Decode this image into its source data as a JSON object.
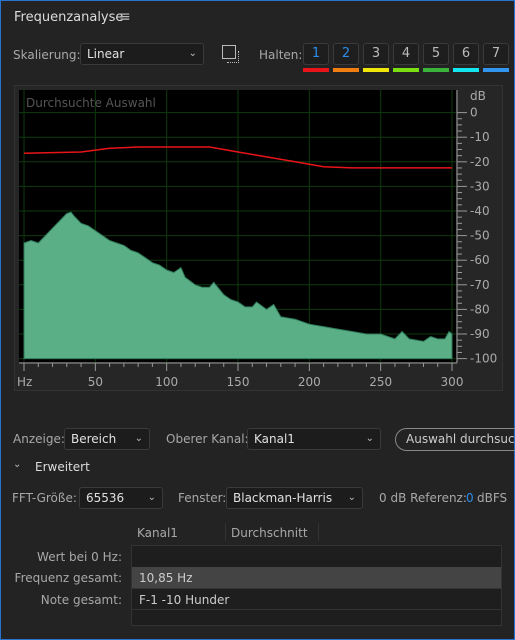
{
  "panel": {
    "title": "Frequenzanalyse",
    "menu_icon": "hamburger-icon"
  },
  "toolbar": {
    "scaling_label": "Skalierung:",
    "scaling_value": "Linear",
    "snapshot_icon": "snapshot-icon",
    "hold_label": "Halten:",
    "hold_buttons": [
      {
        "label": "1",
        "color": "#e8141a",
        "active": true
      },
      {
        "label": "2",
        "color": "#f07e10",
        "active": true
      },
      {
        "label": "3",
        "color": "#f0e60a",
        "active": false
      },
      {
        "label": "4",
        "color": "#7ae014",
        "active": false
      },
      {
        "label": "5",
        "color": "#3cb43c",
        "active": false
      },
      {
        "label": "6",
        "color": "#14e6f0",
        "active": false
      },
      {
        "label": "7",
        "color": "#3296f0",
        "active": false
      }
    ]
  },
  "chart_data": {
    "type": "area",
    "title": "Durchsuchte Auswahl",
    "xlabel": "Hz",
    "ylabel": "dB",
    "xlim": [
      0,
      300
    ],
    "ylim": [
      -100,
      0
    ],
    "grid": true,
    "x_ticks": [
      "50",
      "100",
      "150",
      "200",
      "250",
      "300"
    ],
    "y_ticks": [
      "0",
      "-10",
      "-20",
      "-30",
      "-40",
      "-50",
      "-60",
      "-70",
      "-80",
      "-90",
      "-100"
    ],
    "series": [
      {
        "kind": "spectrum",
        "color": "#5aaf87",
        "points": [
          [
            0,
            -53
          ],
          [
            5,
            -52
          ],
          [
            10,
            -53
          ],
          [
            15,
            -50
          ],
          [
            20,
            -47
          ],
          [
            25,
            -44
          ],
          [
            30,
            -41
          ],
          [
            33,
            -40.5
          ],
          [
            35,
            -42
          ],
          [
            40,
            -45
          ],
          [
            45,
            -46
          ],
          [
            50,
            -48
          ],
          [
            55,
            -50
          ],
          [
            60,
            -52
          ],
          [
            65,
            -53
          ],
          [
            70,
            -54
          ],
          [
            75,
            -56
          ],
          [
            80,
            -57
          ],
          [
            85,
            -59
          ],
          [
            90,
            -61
          ],
          [
            95,
            -62
          ],
          [
            100,
            -64
          ],
          [
            105,
            -65
          ],
          [
            110,
            -63
          ],
          [
            113,
            -67
          ],
          [
            120,
            -70
          ],
          [
            125,
            -71
          ],
          [
            130,
            -71
          ],
          [
            133,
            -69
          ],
          [
            140,
            -74
          ],
          [
            145,
            -76
          ],
          [
            150,
            -77
          ],
          [
            155,
            -79
          ],
          [
            160,
            -79
          ],
          [
            163,
            -77
          ],
          [
            170,
            -80
          ],
          [
            175,
            -78
          ],
          [
            180,
            -83
          ],
          [
            190,
            -84
          ],
          [
            200,
            -86
          ],
          [
            210,
            -87
          ],
          [
            220,
            -88
          ],
          [
            230,
            -89
          ],
          [
            240,
            -90
          ],
          [
            250,
            -90
          ],
          [
            255,
            -91
          ],
          [
            260,
            -92
          ],
          [
            265,
            -89
          ],
          [
            270,
            -92
          ],
          [
            280,
            -93
          ],
          [
            285,
            -91
          ],
          [
            290,
            -92
          ],
          [
            295,
            -92
          ],
          [
            298,
            -89
          ],
          [
            300,
            -90
          ]
        ]
      },
      {
        "kind": "hold",
        "color": "#e8141a",
        "points": [
          [
            0,
            -16.5
          ],
          [
            40,
            -16
          ],
          [
            60,
            -14.5
          ],
          [
            80,
            -14
          ],
          [
            130,
            -14
          ],
          [
            150,
            -16
          ],
          [
            170,
            -18
          ],
          [
            190,
            -20
          ],
          [
            210,
            -22
          ],
          [
            230,
            -22.5
          ],
          [
            300,
            -22.5
          ]
        ]
      }
    ]
  },
  "controls": {
    "display_label": "Anzeige:",
    "display_value": "Bereich",
    "channel_label": "Oberer Kanal:",
    "channel_value": "Kanal1",
    "scan_button": "Auswahl durchsuchen",
    "advanced_label": "Erweitert",
    "fft_label": "FFT-Größe:",
    "fft_value": "65536",
    "window_label": "Fenster:",
    "window_value": "Blackman-Harris",
    "ref_label": "0 dB Referenz:",
    "ref_value": "0",
    "ref_unit": "dBFS"
  },
  "table": {
    "headers": [
      "Kanal1",
      "Durchschnitt"
    ],
    "rows": [
      {
        "label": "Wert bei 0 Hz:",
        "value": ""
      },
      {
        "label": "Frequenz gesamt:",
        "value": "10,85 Hz"
      },
      {
        "label": "Note gesamt:",
        "value": "F-1 -10 Hunder"
      }
    ]
  }
}
